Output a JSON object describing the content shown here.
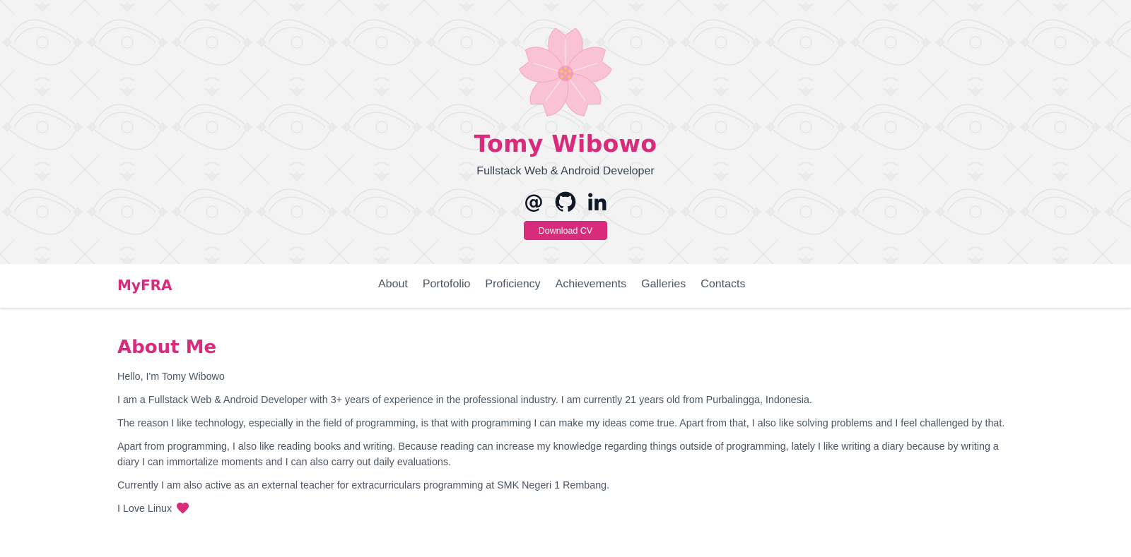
{
  "hero": {
    "name": "Tomy Wibowo",
    "role": "Fullstack Web & Android Developer",
    "socials": [
      {
        "name": "email-icon"
      },
      {
        "name": "github-icon"
      },
      {
        "name": "linkedin-icon"
      }
    ],
    "cv_button": "Download CV"
  },
  "nav": {
    "brand": "MyFRA",
    "links": [
      "About",
      "Portofolio",
      "Proficiency",
      "Achievements",
      "Galleries",
      "Contacts"
    ]
  },
  "about": {
    "title": "About Me",
    "paragraphs": [
      "Hello, I'm Tomy Wibowo",
      "I am a Fullstack Web & Android Developer with 3+ years of experience in the professional industry. I am currently 21 years old from Purbalingga, Indonesia.",
      "The reason I like technology, especially in the field of programming, is that with programming I can make my ideas come true. Apart from that, I also like solving problems and I feel challenged by that.",
      "Apart from programming, I also like reading books and writing. Because reading can increase my knowledge regarding things outside of programming, lately I like writing a diary because by writing a diary I can immortalize moments and I can also carry out daily evaluations.",
      "Currently I am also active as an external teacher for extracurriculars programming at SMK Negeri 1 Rembang."
    ],
    "closing": "I Love Linux"
  },
  "colors": {
    "accent": "#d92b7b",
    "text": "#4b5563",
    "hero_bg": "#f3f3f3",
    "flower_petal": "#f8bbd0"
  }
}
